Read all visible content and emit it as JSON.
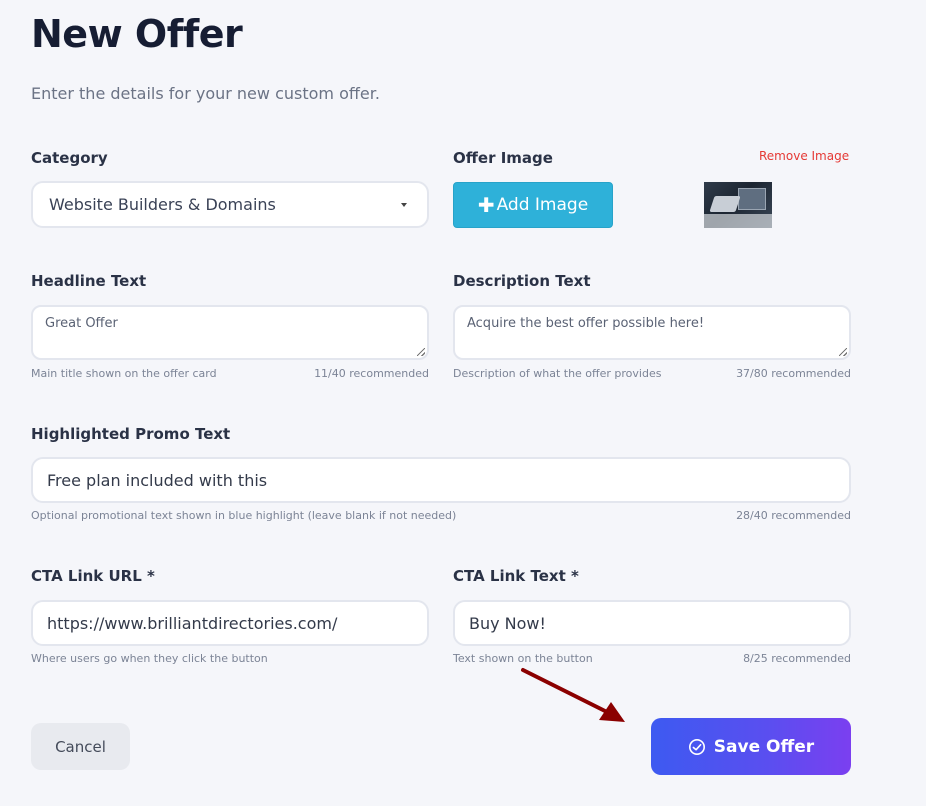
{
  "header": {
    "title": "New Offer",
    "subtitle": "Enter the details for your new custom offer."
  },
  "category": {
    "label": "Category",
    "selected": "Website Builders & Domains"
  },
  "offer_image": {
    "label": "Offer Image",
    "remove_label": "Remove Image",
    "add_label": "Add Image"
  },
  "headline": {
    "label": "Headline Text",
    "value": "Great Offer",
    "hint": "Main title shown on the offer card",
    "count": "11/40 recommended"
  },
  "description": {
    "label": "Description Text",
    "value": "Acquire the best offer possible here!",
    "hint": "Description of what the offer provides",
    "count": "37/80 recommended"
  },
  "promo": {
    "label": "Highlighted Promo Text",
    "value": "Free plan included with this",
    "hint": "Optional promotional text shown in blue highlight (leave blank if not needed)",
    "count": "28/40 recommended"
  },
  "cta_url": {
    "label": "CTA Link URL *",
    "value": "https://www.brilliantdirectories.com/",
    "hint": "Where users go when they click the button"
  },
  "cta_text": {
    "label": "CTA Link Text *",
    "value": "Buy Now!",
    "hint": "Text shown on the button",
    "count": "8/25 recommended"
  },
  "actions": {
    "cancel_label": "Cancel",
    "save_label": "Save Offer"
  },
  "colors": {
    "accent": "#3d5af1",
    "add_image_button": "#2eb1d9",
    "remove_link": "#e53935",
    "annotation_arrow": "#8b0000"
  }
}
